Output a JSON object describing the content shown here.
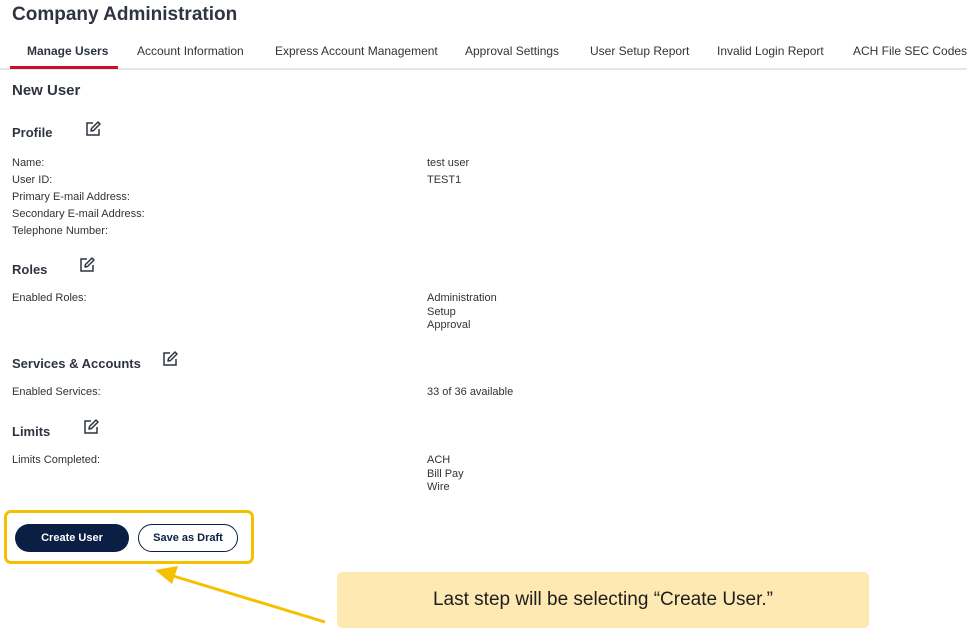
{
  "header": {
    "title": "Company Administration"
  },
  "tabs": [
    {
      "label": "Manage Users"
    },
    {
      "label": "Account Information"
    },
    {
      "label": "Express Account Management"
    },
    {
      "label": "Approval Settings"
    },
    {
      "label": "User Setup Report"
    },
    {
      "label": "Invalid Login Report"
    },
    {
      "label": "ACH File SEC Codes"
    }
  ],
  "main": {
    "heading": "New User",
    "profile": {
      "title": "Profile",
      "fields": [
        {
          "label": "Name:",
          "value": "test user"
        },
        {
          "label": "User ID:",
          "value": "TEST1"
        },
        {
          "label": "Primary E-mail Address:",
          "value": ""
        },
        {
          "label": "Secondary E-mail Address:",
          "value": ""
        },
        {
          "label": "Telephone Number:",
          "value": ""
        }
      ]
    },
    "roles": {
      "title": "Roles",
      "label": "Enabled Roles:",
      "values": [
        "Administration",
        "Setup",
        "Approval"
      ]
    },
    "services": {
      "title": "Services & Accounts",
      "label": "Enabled Services:",
      "value": "33 of 36 available"
    },
    "limits": {
      "title": "Limits",
      "label": "Limits Completed:",
      "values": [
        "ACH",
        "Bill Pay",
        "Wire"
      ]
    }
  },
  "actions": {
    "create_label": "Create User",
    "draft_label": "Save as Draft"
  },
  "annotation": {
    "callout_text": "Last step will be selecting “Create User.”",
    "highlight_color": "#f5c000",
    "callout_bg": "#fde9b1"
  },
  "colors": {
    "accent": "#c8102e",
    "primary": "#0b1f45"
  }
}
